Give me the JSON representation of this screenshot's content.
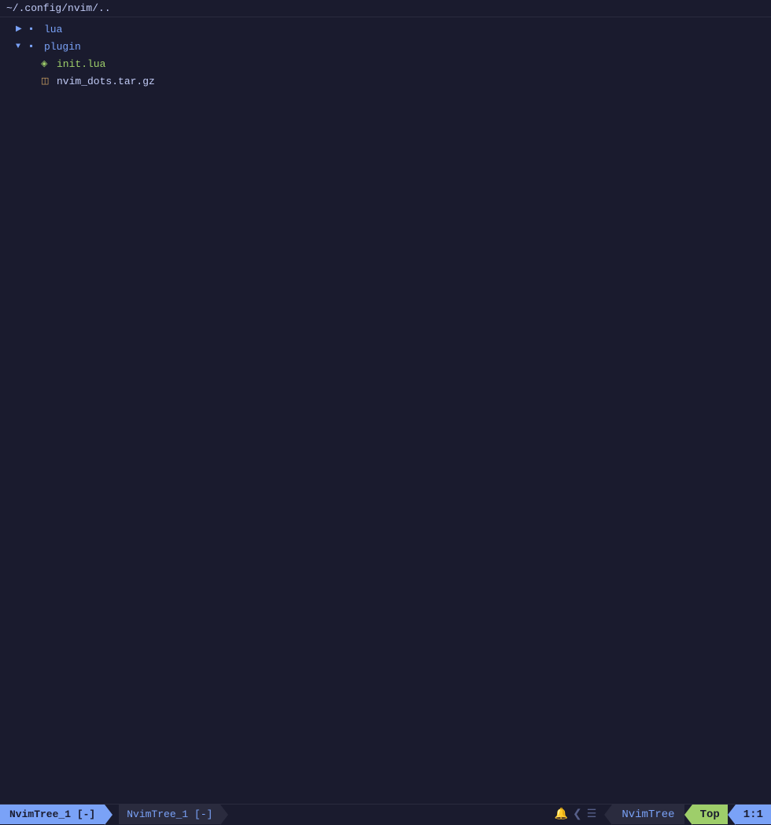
{
  "titleBar": {
    "path": "~/.config/nvim/.."
  },
  "tree": {
    "items": [
      {
        "id": "root",
        "indent": "indent-0",
        "arrow": "",
        "folderIcon": "",
        "fileIcon": "📁",
        "label": "~/.config/nvim/..",
        "labelClass": "label-folder",
        "type": "root-label",
        "hasArrow": false,
        "isFile": false
      },
      {
        "id": "lua",
        "indent": "indent-1",
        "arrow": "▶",
        "label": "lua",
        "labelClass": "label-folder",
        "type": "folder-closed",
        "hasArrow": true
      },
      {
        "id": "plugin",
        "indent": "indent-1",
        "arrow": "▼",
        "label": "plugin",
        "labelClass": "label-folder",
        "type": "folder-open",
        "hasArrow": true
      },
      {
        "id": "init-lua",
        "indent": "indent-2",
        "arrow": "",
        "label": "init.lua",
        "labelClass": "label-lua",
        "type": "file-lua",
        "hasArrow": false,
        "isFile": true
      },
      {
        "id": "nvim-dots",
        "indent": "indent-2",
        "arrow": "",
        "label": "nvim_dots.tar.gz",
        "labelClass": "label-archive",
        "type": "file-archive",
        "hasArrow": false,
        "isFile": true
      }
    ]
  },
  "statusBar": {
    "leftActive": "NvimTree_1 [-]",
    "leftActiveArrow": "▶",
    "leftInactive": "NvimTree_1 [-]",
    "leftInactiveArrow": "▶",
    "icon1": "🔔",
    "icon2": "❮",
    "icon3": "≡",
    "nvimtreeLabel": "NvimTree",
    "topLabel": "Top",
    "posLabel": "1:1"
  }
}
